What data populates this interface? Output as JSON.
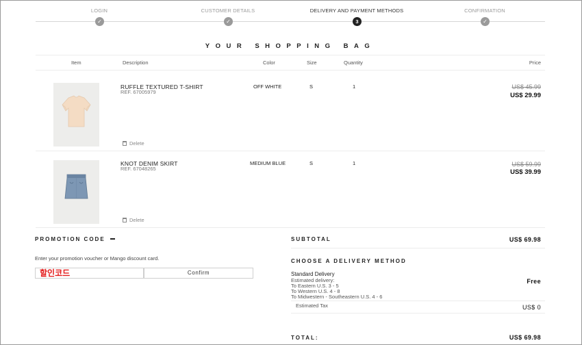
{
  "progress": {
    "steps": [
      {
        "label": "LOGIN",
        "state": "done",
        "marker": "✓"
      },
      {
        "label": "CUSTOMER DETAILS",
        "state": "done",
        "marker": "✓"
      },
      {
        "label": "DELIVERY AND PAYMENT METHODS",
        "state": "active",
        "marker": "3"
      },
      {
        "label": "CONFIRMATION",
        "state": "done",
        "marker": "✓"
      }
    ]
  },
  "bag": {
    "title": "YOUR SHOPPING BAG",
    "headers": {
      "item": "Item",
      "description": "Description",
      "color": "Color",
      "size": "Size",
      "quantity": "Quantity",
      "price": "Price"
    },
    "items": [
      {
        "name": "RUFFLE TEXTURED T-SHIRT",
        "ref": "REF. 67005979",
        "color": "OFF WHITE",
        "size": "S",
        "quantity": "1",
        "old_price": "US$ 45.99",
        "price": "US$ 29.99",
        "delete": "Delete",
        "image": "tshirt-photo"
      },
      {
        "name": "KNOT DENIM SKIRT",
        "ref": "REF. 67048265",
        "color": "MEDIUM BLUE",
        "size": "S",
        "quantity": "1",
        "old_price": "US$ 59.99",
        "price": "US$ 39.99",
        "delete": "Delete",
        "image": "skirt-photo"
      }
    ]
  },
  "promo": {
    "title": "PROMOTION CODE",
    "toggle_icon": "minus-icon",
    "text": "Enter your promotion voucher or Mango discount card.",
    "input_overlay": "할인코드",
    "input_value": "",
    "confirm": "Confirm"
  },
  "summary": {
    "subtotal_label": "SUBTOTAL",
    "subtotal": "US$ 69.98",
    "delivery_title": "CHOOSE A DELIVERY METHOD",
    "delivery_name": "Standard Delivery",
    "delivery_lines": [
      "Estimated delivery:",
      "To Eastern U.S. 3 - 5",
      "To Western U.S. 4 - 8",
      "To Midwestern - Southeastern U.S. 4 - 6"
    ],
    "delivery_price": "Free",
    "tax_label": "Estimated Tax",
    "tax": "US$ 0",
    "total_label": "TOTAL:",
    "total": "US$ 69.98"
  },
  "colors": {
    "active_step": "#222222",
    "done_step": "#9a9a9a",
    "overlay_text": "#e31b1b"
  }
}
